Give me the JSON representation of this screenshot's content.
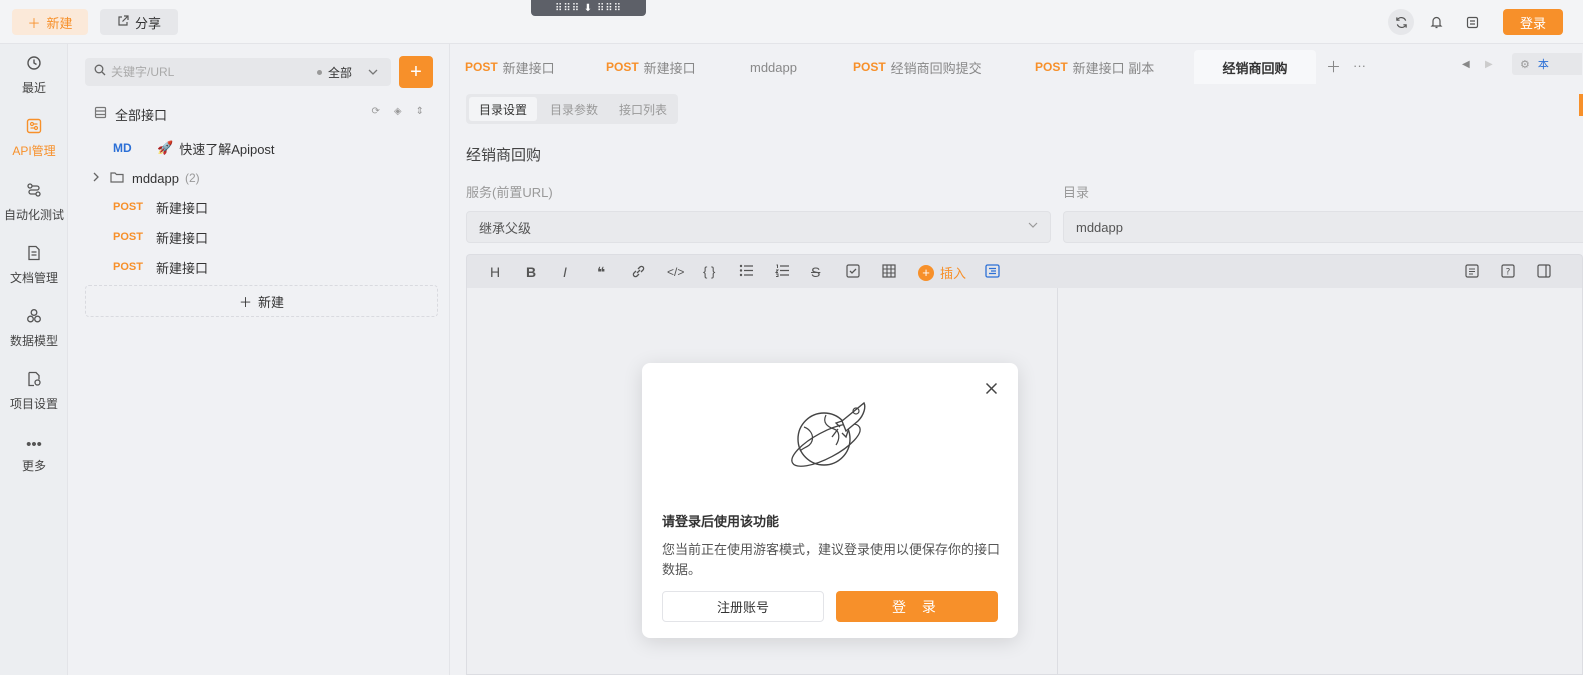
{
  "topbar": {
    "new_label": "新建",
    "share_label": "分享",
    "login_label": "登录"
  },
  "leftnav": [
    {
      "label": "最近",
      "icon": "clock-icon"
    },
    {
      "label": "API管理",
      "icon": "api-icon",
      "active": true
    },
    {
      "label": "自动化测试",
      "icon": "flow-icon"
    },
    {
      "label": "文档管理",
      "icon": "document-icon"
    },
    {
      "label": "数据模型",
      "icon": "model-icon"
    },
    {
      "label": "项目设置",
      "icon": "settings-icon"
    },
    {
      "label": "更多",
      "icon": "more-icon"
    }
  ],
  "tree": {
    "search_placeholder": "关键字/URL",
    "filter_label": "全部",
    "root_label": "全部接口",
    "items": [
      {
        "method": "MD",
        "label": "快速了解Apipost"
      },
      {
        "method": "",
        "label": "mddapp",
        "count": "(2)"
      },
      {
        "method": "POST",
        "label": "新建接口"
      },
      {
        "method": "POST",
        "label": "新建接口"
      },
      {
        "method": "POST",
        "label": "新建接口"
      }
    ],
    "new_label": "新建"
  },
  "tabs": [
    {
      "method": "POST",
      "label": "新建接口"
    },
    {
      "method": "POST",
      "label": "新建接口"
    },
    {
      "method": "",
      "label": "mddapp"
    },
    {
      "method": "POST",
      "label": "经销商回购提交"
    },
    {
      "method": "POST",
      "label": "新建接口 副本"
    },
    {
      "method": "",
      "label": "经销商回购",
      "active": true
    }
  ],
  "env_label": "本",
  "main": {
    "subtabs": [
      "目录设置",
      "目录参数",
      "接口列表"
    ],
    "title": "经销商回购",
    "service_label": "服务(前置URL)",
    "service_value": "继承父级",
    "dir_label": "目录",
    "dir_value": "mddapp",
    "insert_label": "插入"
  },
  "modal": {
    "title": "请登录后使用该功能",
    "description": "您当前正在使用游客模式，建议登录使用以便保存你的接口数据。",
    "register_label": "注册账号",
    "login_label": "登 录"
  },
  "colors": {
    "accent": "#f7902a",
    "md_blue": "#2b6fd6"
  }
}
